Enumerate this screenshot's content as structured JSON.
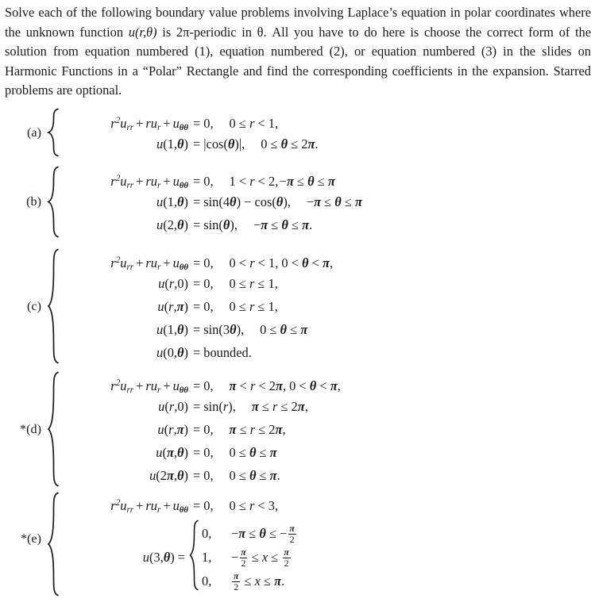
{
  "document": {
    "type": "math-homework-problem",
    "background_color": "#ffffff",
    "text_color": "#1a1a1a"
  },
  "intro": {
    "line1_a": "Solve each of the following boundary value problems involving Laplace’s equation in polar",
    "line2_a": "coordinates where the unknown function ",
    "line2_math": "u(r,θ)",
    "line2_b": " is 2π-periodic in θ. All you have to do here",
    "line3": "is choose the correct form of the solution from equation numbered (1), equation numbered",
    "line4": "(2), or equation numbered (3) in the slides on Harmonic Functions in a “Polar” Rectangle",
    "line5": "and find the corresponding coefficients in the expansion. Starred problems are optional.",
    "full_text": "Solve each of the following boundary value problems involving Laplace’s equation in polar coordinates where the unknown function u(r,θ) is 2π-periodic in θ. All you have to do here is choose the correct form of the solution from equation numbered (1), equation numbered (2), or equation numbered (3) in the slides on Harmonic Functions in a “Polar” Rectangle and find the corresponding coefficients in the expansion. Starred problems are optional."
  },
  "pde": {
    "r": "r",
    "power": "2",
    "u": "u",
    "sub_rr": "rr",
    "sub_r": "r",
    "sub_tt": "θθ",
    "plus": "+",
    "equals": "=",
    "zero": "0,"
  },
  "problems": [
    {
      "id": "a",
      "label": "(a)",
      "starred": false,
      "lines": [
        {
          "lhs": "r²uₚₚ + ruₚ + uθθ",
          "rhs": "= 0,",
          "cond": "0 ≤ r < 1,"
        },
        {
          "lhs": "u(1,θ)",
          "rhs": "= |cos(θ)|,",
          "cond": "0 ≤ θ ≤ 2π."
        }
      ]
    },
    {
      "id": "b",
      "label": "(b)",
      "starred": false,
      "lines": [
        {
          "lhs": "r²uₚₚ + ruₚ + uθθ",
          "rhs": "= 0,",
          "cond": "1 < r < 2, −π ≤ θ ≤ π"
        },
        {
          "lhs": "u(1,θ)",
          "rhs": "= sin(4θ) − cos(θ),",
          "cond": "−π ≤ θ ≤ π"
        },
        {
          "lhs": "u(2,θ)",
          "rhs": "= sin(θ),",
          "cond": "−π ≤ θ ≤ π."
        }
      ]
    },
    {
      "id": "c",
      "label": "(c)",
      "starred": false,
      "lines": [
        {
          "lhs": "r²uₚₚ + ruₚ + uθθ",
          "rhs": "= 0,",
          "cond": "0 < r < 1, 0 < θ < π,"
        },
        {
          "lhs": "u(r,0)",
          "rhs": "= 0,",
          "cond": "0 ≤ r ≤ 1,"
        },
        {
          "lhs": "u(r,π)",
          "rhs": "= 0,",
          "cond": "0 ≤ r ≤ 1,"
        },
        {
          "lhs": "u(1,θ)",
          "rhs": "= sin(3θ),",
          "cond": "0 ≤ θ ≤ π"
        },
        {
          "lhs": "u(0,θ)",
          "rhs": "= bounded.",
          "cond": ""
        }
      ]
    },
    {
      "id": "d",
      "label": "*(d)",
      "starred": true,
      "lines": [
        {
          "lhs": "r²uₚₚ + ruₚ + uθθ",
          "rhs": "= 0,",
          "cond": "π < r < 2π, 0 < θ < π,"
        },
        {
          "lhs": "u(r,0)",
          "rhs": "= sin(r),",
          "cond": "π ≤ r ≤ 2π,"
        },
        {
          "lhs": "u(r,π)",
          "rhs": "= 0,",
          "cond": "π ≤ r ≤ 2π,"
        },
        {
          "lhs": "u(π,θ)",
          "rhs": "= 0,",
          "cond": "0 ≤ θ ≤ π"
        },
        {
          "lhs": "u(2π,θ)",
          "rhs": "= 0,",
          "cond": "0 ≤ θ ≤ π."
        }
      ]
    },
    {
      "id": "e",
      "label": "*(e)",
      "starred": true,
      "lines": [
        {
          "lhs": "r²uₚₚ + ruₚ + uθθ",
          "rhs": "= 0,",
          "cond": "0 ≤ r < 3,"
        },
        {
          "lhs": "u(3,θ)",
          "rhs": "= cases",
          "cond": ""
        }
      ],
      "cases": [
        {
          "value": "0,",
          "cond_pre": "−π ≤ θ ≤ −",
          "frac_num": "π",
          "frac_den": "2",
          "cond_post": ""
        },
        {
          "value": "1,",
          "cond_pre": "−",
          "frac_num": "π",
          "frac_den": "2",
          "cond_mid": "≤ x ≤",
          "frac2_num": "π",
          "frac2_den": "2",
          "cond_post": ""
        },
        {
          "value": "0,",
          "cond_pre": "",
          "frac_num": "π",
          "frac_den": "2",
          "cond_mid": "≤ x ≤ π.",
          "cond_post": ""
        }
      ]
    }
  ]
}
